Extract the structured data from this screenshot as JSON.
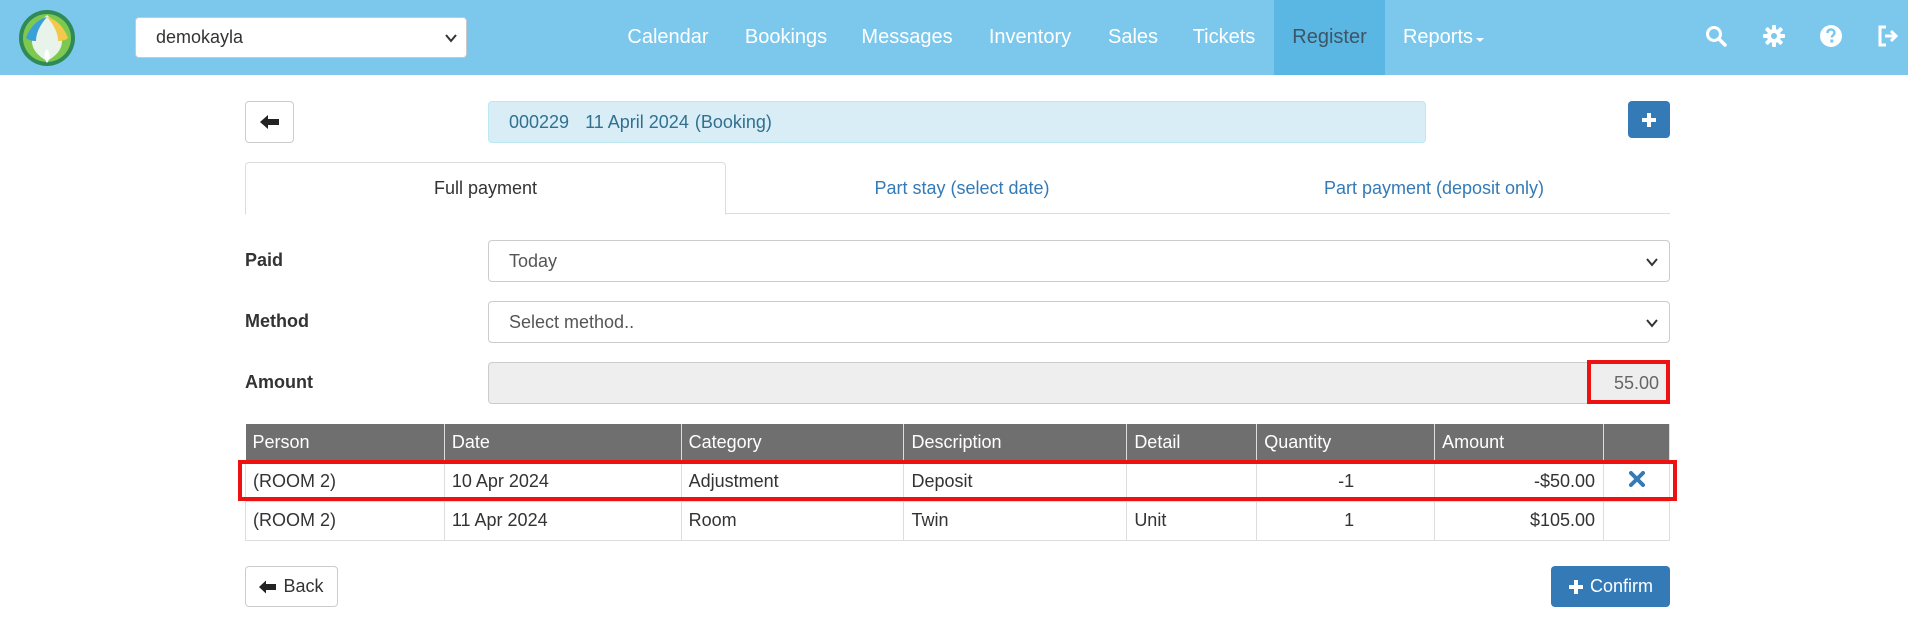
{
  "navbar": {
    "org_select": "demokayla",
    "items": [
      {
        "label": "Calendar"
      },
      {
        "label": "Bookings"
      },
      {
        "label": "Messages"
      },
      {
        "label": "Inventory"
      },
      {
        "label": "Sales"
      },
      {
        "label": "Tickets"
      },
      {
        "label": "Register"
      },
      {
        "label": "Reports"
      }
    ],
    "active_item": "Register",
    "icons": [
      "search-icon",
      "gear-icon",
      "help-icon",
      "logout-icon"
    ]
  },
  "booking": {
    "number": "000229",
    "date": "11 April 2024",
    "type": "(Booking)"
  },
  "tabs": [
    {
      "label": "Full payment",
      "active": true
    },
    {
      "label": "Part stay (select date)",
      "active": false
    },
    {
      "label": "Part payment (deposit only)",
      "active": false
    }
  ],
  "form": {
    "paid_label": "Paid",
    "paid_value": "Today",
    "method_label": "Method",
    "method_value": "Select method..",
    "amount_label": "Amount",
    "amount_value": "55.00"
  },
  "table": {
    "headers": [
      "Person",
      "Date",
      "Category",
      "Description",
      "Detail",
      "Quantity",
      "Amount",
      ""
    ],
    "rows": [
      {
        "person": "(ROOM 2)",
        "date": "10 Apr 2024",
        "category": "Adjustment",
        "description": "Deposit",
        "detail": "",
        "quantity": "-1",
        "amount": "-$50.00",
        "removable": true
      },
      {
        "person": "(ROOM 2)",
        "date": "11 Apr 2024",
        "category": "Room",
        "description": "Twin",
        "detail": "Unit",
        "quantity": "1",
        "amount": "$105.00",
        "removable": false
      }
    ]
  },
  "buttons": {
    "back": "Back",
    "confirm": "Confirm"
  },
  "colors": {
    "navbar": "#7cc8ec",
    "navbar_active": "#5ab6e2",
    "primary": "#337ab7",
    "info_bg": "#d9edf7",
    "table_header": "#6f6f6f",
    "highlight": "#ee1111"
  }
}
